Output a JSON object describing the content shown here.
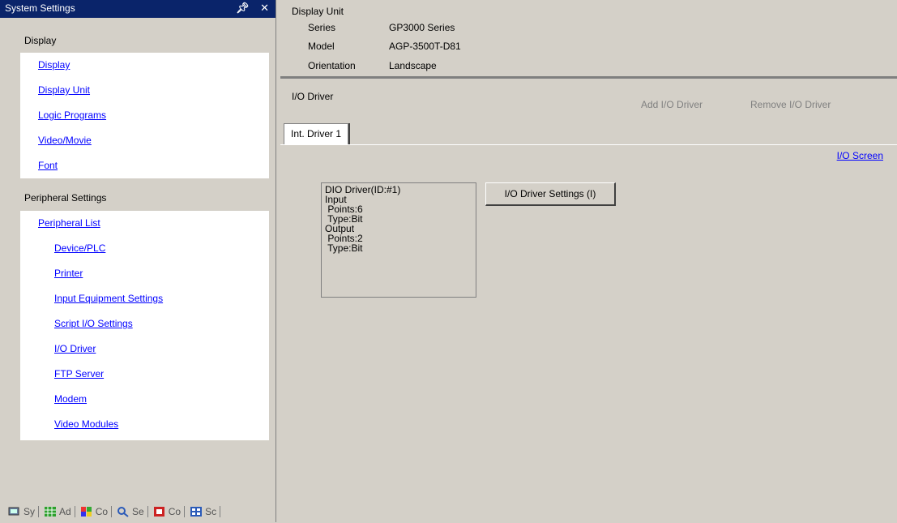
{
  "panel": {
    "title": "System Settings",
    "pin_glyph": "↓",
    "close_glyph": "✕"
  },
  "settings": {
    "display_group": {
      "header": "Display",
      "items": [
        "Display",
        "Display Unit",
        "Logic Programs",
        "Video/Movie",
        "Font"
      ]
    },
    "peripheral_group": {
      "header": "Peripheral Settings",
      "list_label": "Peripheral List",
      "items": [
        "Device/PLC",
        "Printer",
        "Input Equipment Settings",
        "Script I/O Settings",
        "I/O Driver",
        "FTP Server",
        "Modem",
        "Video Modules"
      ]
    }
  },
  "bottom_tabs": [
    {
      "icon": "system-settings-icon",
      "label": "Sy"
    },
    {
      "icon": "address-icon",
      "label": "Ad"
    },
    {
      "icon": "common-settings-icon",
      "label": "Co"
    },
    {
      "icon": "search-icon",
      "label": "Se"
    },
    {
      "icon": "component-icon",
      "label": "Co"
    },
    {
      "icon": "screen-list-icon",
      "label": "Sc"
    }
  ],
  "display_unit": {
    "heading": "Display Unit",
    "series_label": "Series",
    "series_value": "GP3000 Series",
    "model_label": "Model",
    "model_value": "AGP-3500T-D81",
    "orientation_label": "Orientation",
    "orientation_value": "Landscape"
  },
  "io_driver": {
    "heading": "I/O Driver",
    "add_label": "Add I/O Driver",
    "remove_label": "Remove I/O Driver",
    "tab_label": "Int. Driver 1",
    "io_screen_link": "I/O Screen",
    "driver_box_lines": [
      "DIO Driver(ID:#1)",
      "Input",
      " Points:6",
      " Type:Bit",
      "Output",
      " Points:2",
      " Type:Bit"
    ],
    "settings_button": "I/O Driver Settings (I)"
  },
  "colors": {
    "title_bar": "#0a246a",
    "link": "#0000ff",
    "face": "#d4d0c8"
  }
}
